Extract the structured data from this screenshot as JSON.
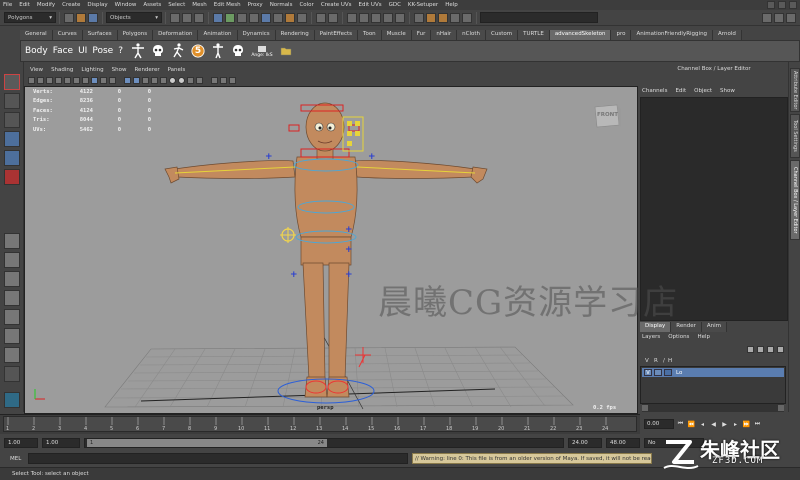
{
  "menubar": {
    "items": [
      "File",
      "Edit",
      "Modify",
      "Create",
      "Display",
      "Window",
      "Assets",
      "Select",
      "Mesh",
      "Edit Mesh",
      "Proxy",
      "Normals",
      "Color",
      "Create UVs",
      "Edit UVs",
      "GDC",
      "KK-Setuper",
      "Help"
    ]
  },
  "statusline": {
    "mode": "Polygons",
    "selection_mode": "Objects"
  },
  "shelf": {
    "tabs": [
      "General",
      "Curves",
      "Surfaces",
      "Polygons",
      "Deformation",
      "Animation",
      "Dynamics",
      "Rendering",
      "PaintEffects",
      "Toon",
      "Muscle",
      "Fur",
      "nHair",
      "nCloth",
      "Custom",
      "TURTLE",
      "advancedSkeleton",
      "pro",
      "AnimationFriendlyRigging",
      "Arnold"
    ],
    "active_tab": "advancedSkeleton",
    "labels": [
      "Body",
      "Face",
      "UI",
      "Pose",
      "?"
    ],
    "icon_numeral": "5",
    "icon_caption": "Ange: IkS"
  },
  "viewport": {
    "menu": [
      "View",
      "Shading",
      "Lighting",
      "Show",
      "Renderer",
      "Panels"
    ],
    "hud": [
      {
        "label": "Verts:",
        "v1": "4122",
        "v2": "0",
        "v3": "0"
      },
      {
        "label": "Edges:",
        "v1": "8236",
        "v2": "0",
        "v3": "0"
      },
      {
        "label": "Faces:",
        "v1": "4124",
        "v2": "0",
        "v3": "0"
      },
      {
        "label": "Tris:",
        "v1": "8044",
        "v2": "0",
        "v3": "0"
      },
      {
        "label": "UVs:",
        "v1": "5462",
        "v2": "0",
        "v3": "0"
      }
    ],
    "viewcube": "FRONT",
    "camera_label": "persp",
    "fps": "0.2 fps"
  },
  "channelbox": {
    "title": "Channel Box / Layer Editor",
    "menu": [
      "Channels",
      "Edit",
      "Object",
      "Show"
    ]
  },
  "right_tabs": [
    "Attribute Editor",
    "Tool Settings",
    "Channel Box / Layer Editor"
  ],
  "layers": {
    "tabs": [
      "Display",
      "Render",
      "Anim"
    ],
    "menu": [
      "Layers",
      "Options",
      "Help"
    ],
    "header": [
      "V",
      "R",
      "/",
      "H"
    ],
    "rows": [
      {
        "v": "V",
        "name": "Lo"
      }
    ]
  },
  "timeslider": {
    "ticks": [
      "1",
      "2",
      "3",
      "4",
      "5",
      "6",
      "7",
      "8",
      "9",
      "10",
      "11",
      "12",
      "13",
      "14",
      "15",
      "16",
      "17",
      "18",
      "19",
      "20",
      "21",
      "22",
      "23",
      "24"
    ],
    "current": "0.00"
  },
  "range": {
    "start": "1.00",
    "playback_start": "1.00",
    "handle_start": "1",
    "handle_end": "24",
    "playback_end": "24.00",
    "end": "48.00",
    "no_char_set": "No"
  },
  "cmdline": {
    "label": "MEL",
    "result": "// Warning: line 0: This file is from an older version of Maya.  If saved, it will not be readable by previous versions."
  },
  "helpline": {
    "text": "Select Tool: select an object"
  },
  "watermark": {
    "main": "晨曦CG资源学习店",
    "logo_text": "朱峰社区",
    "logo_url": "ZF3D.COM"
  }
}
